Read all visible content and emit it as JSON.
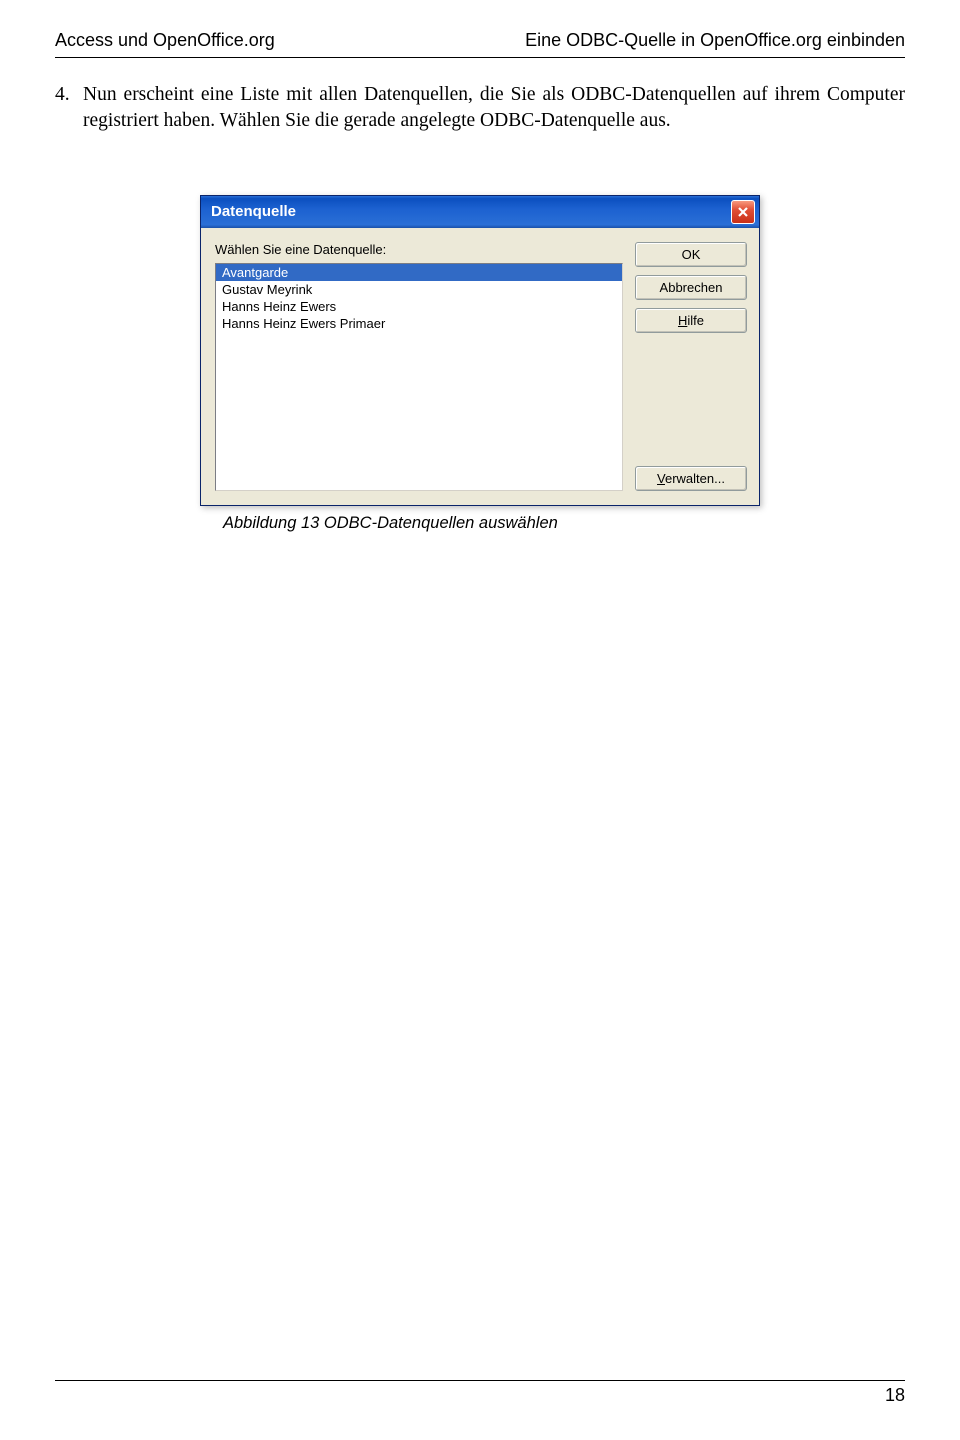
{
  "header": {
    "left": "Access und OpenOffice.org",
    "right": "Eine ODBC-Quelle in OpenOffice.org einbinden"
  },
  "paragraph": {
    "num": "4.",
    "text": "Nun erscheint eine Liste mit allen Datenquellen, die Sie als ODBC-Daten­quellen auf ihrem Computer registriert haben. Wählen Sie die gerade ange­legte ODBC-Datenquelle aus."
  },
  "dialog": {
    "title": "Datenquelle",
    "prompt": "Wählen Sie eine Datenquelle:",
    "items": [
      "Avantgarde",
      "Gustav Meyrink",
      "Hanns Heinz Ewers",
      "Hanns Heinz Ewers Primaer"
    ],
    "buttons": {
      "ok": "OK",
      "cancel": "Abbrechen",
      "help_prefix": "H",
      "help_rest": "ilfe",
      "manage_prefix": "V",
      "manage_rest": "erwalten..."
    }
  },
  "caption": "Abbildung 13 ODBC-Datenquellen auswählen",
  "page_number": "18"
}
